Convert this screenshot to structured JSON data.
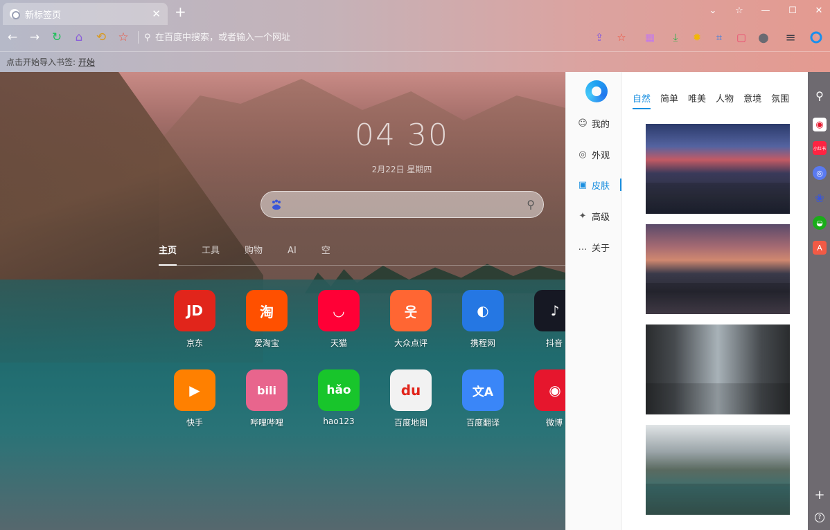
{
  "tab": {
    "title": "新标签页",
    "close": "✕"
  },
  "window": {
    "dropdown": "⌄",
    "pin": "☆",
    "minimize": "—",
    "maximize": "☐",
    "close": "✕"
  },
  "toolbar": {
    "back": "←",
    "forward": "→",
    "reload": "↻",
    "home": "⌂",
    "undo": "⟲",
    "favorite": "☆"
  },
  "address": {
    "placeholder": "在百度中搜索，或者输入一个网址",
    "search_glyph": "⚲"
  },
  "toolbar_right": {
    "share": "⇪",
    "star": "☆",
    "grid": "▦",
    "download": "⤓",
    "sun": "✹",
    "capture": "⌗",
    "gift": "▢",
    "user": "●",
    "menu": "≡"
  },
  "bookmarks": {
    "prompt": "点击开始导入书签:",
    "link": "开始"
  },
  "clock": {
    "time": "04 30",
    "date": "2月22日 星期四"
  },
  "search": {
    "engine_glyph": "du",
    "placeholder": "",
    "button_glyph": "⚲"
  },
  "navtabs": [
    "主页",
    "工具",
    "购物",
    "AI",
    "空"
  ],
  "apps": [
    {
      "label": "京东",
      "glyph": "JD",
      "color": "#e1251b"
    },
    {
      "label": "爱淘宝",
      "glyph": "淘",
      "color": "#ff5000"
    },
    {
      "label": "天猫",
      "glyph": "◡",
      "color": "#ff0036"
    },
    {
      "label": "大众点评",
      "glyph": "웃",
      "color": "#ff6633"
    },
    {
      "label": "携程网",
      "glyph": "◐",
      "color": "#2577e3"
    },
    {
      "label": "抖音",
      "glyph": "♪",
      "color": "#161823"
    },
    {
      "label": "快手",
      "glyph": "▶",
      "color": "#ff8000"
    },
    {
      "label": "哔哩哔哩",
      "glyph": "bili",
      "color": "#e8658d"
    },
    {
      "label": "hao123",
      "glyph": "hǎo",
      "color": "#18c52b"
    },
    {
      "label": "百度地图",
      "glyph": "du",
      "color": "#f2f2f2"
    },
    {
      "label": "百度翻译",
      "glyph": "文A",
      "color": "#3a86f8"
    },
    {
      "label": "微博",
      "glyph": "◉",
      "color": "#e6162d"
    }
  ],
  "panel": {
    "side_items": [
      {
        "label": "我的",
        "glyph": "☺"
      },
      {
        "label": "外观",
        "glyph": "◎"
      },
      {
        "label": "皮肤",
        "glyph": "▣"
      },
      {
        "label": "高级",
        "glyph": "✦"
      },
      {
        "label": "关于",
        "glyph": "…"
      }
    ],
    "skin_tabs": [
      "自然",
      "简单",
      "唯美",
      "人物",
      "意境",
      "氛围"
    ]
  },
  "rsidebar": {
    "search": "⚲",
    "weibo": "◉",
    "xiaohongshu": "小红书",
    "ai": "◎",
    "paw": "❀",
    "wechat": "◒",
    "pdf": "A",
    "add": "+",
    "help": "?"
  },
  "colors": {
    "accent": "#1a8fe0"
  }
}
